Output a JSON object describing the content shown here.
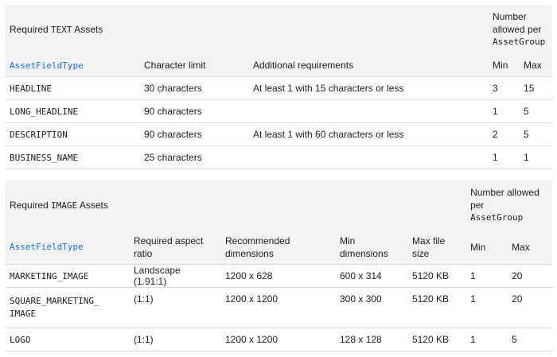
{
  "text_table": {
    "title_prefix": "Required ",
    "title_code": "TEXT",
    "title_suffix": " Assets",
    "allowed_line1": "Number",
    "allowed_line2": "allowed per",
    "allowed_code": "AssetGroup",
    "headers": {
      "field_type": "AssetFieldType",
      "char_limit": "Character limit",
      "additional": "Additional requirements",
      "min": "Min",
      "max": "Max"
    },
    "rows": [
      {
        "field": "HEADLINE",
        "limit": "30 characters",
        "additional": "At least 1 with 15 characters or less",
        "min": "3",
        "max": "15"
      },
      {
        "field": "LONG_HEADLINE",
        "limit": "90 characters",
        "additional": "",
        "min": "1",
        "max": "5"
      },
      {
        "field": "DESCRIPTION",
        "limit": "90 characters",
        "additional": "At least 1 with 60 characters or less",
        "min": "2",
        "max": "5"
      },
      {
        "field": "BUSINESS_NAME",
        "limit": "25 characters",
        "additional": "",
        "min": "1",
        "max": "1"
      }
    ]
  },
  "image_table": {
    "title_prefix": "Required ",
    "title_code": "IMAGE",
    "title_suffix": " Assets",
    "allowed_line1": "Number allowed",
    "allowed_line2": "per",
    "allowed_code": "AssetGroup",
    "headers": {
      "field_type": "AssetFieldType",
      "aspect_line1": "Required aspect",
      "aspect_line2": "ratio",
      "recommended_line1": "Recommended",
      "recommended_line2": "dimensions",
      "min_dim_line1": "Min",
      "min_dim_line2": "dimensions",
      "max_file_line1": "Max file",
      "max_file_line2": "size",
      "min": "Min",
      "max": "Max"
    },
    "rows": [
      {
        "field_line1": "MARKETING_IMAGE",
        "field_line2": "",
        "aspect": "Landscape (1.91:1)",
        "recommended": "1200 x 628",
        "min_dim": "600 x 314",
        "max_file": "5120 KB",
        "min": "1",
        "max": "20"
      },
      {
        "field_line1": "SQUARE_MARKETING_",
        "field_line2": "IMAGE",
        "aspect": "(1:1)",
        "recommended": "1200 x 1200",
        "min_dim": "300 x 300",
        "max_file": "5120 KB",
        "min": "1",
        "max": "20"
      },
      {
        "field_line1": "LOGO",
        "field_line2": "",
        "aspect": "(1:1)",
        "recommended": "1200 x 1200",
        "min_dim": "128 x 128",
        "max_file": "5120 KB",
        "min": "1",
        "max": "5"
      }
    ]
  }
}
